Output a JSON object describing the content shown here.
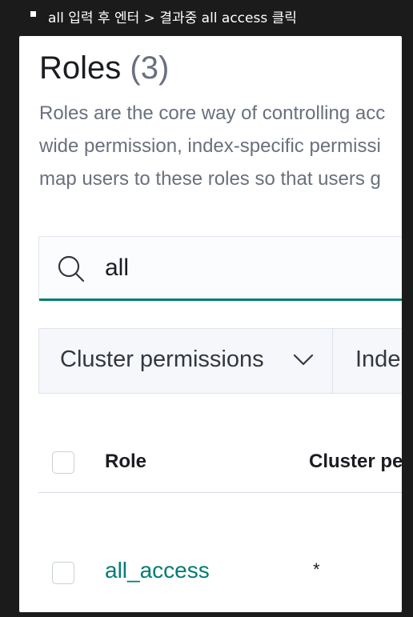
{
  "note": {
    "text": "all 입력 후 엔터 > 결과중 all access 클릭"
  },
  "page": {
    "title": "Roles",
    "count": "(3)",
    "description_lines": [
      "Roles are the core way of controlling acc",
      "wide permission, index-specific permissi",
      "map users to these roles so that users g"
    ]
  },
  "search": {
    "value": "all"
  },
  "filters": {
    "cluster_permissions": "Cluster permissions",
    "index_permissions_partial": "Inde"
  },
  "table": {
    "columns": {
      "role": "Role",
      "cluster_permissions": "Cluster pe"
    },
    "rows": [
      {
        "role": "all_access",
        "cluster_permissions": "*"
      }
    ]
  },
  "colors": {
    "accent": "#017d73",
    "title": "#1a1c21",
    "muted": "#69707d",
    "background_outer": "#1b1b1b"
  }
}
